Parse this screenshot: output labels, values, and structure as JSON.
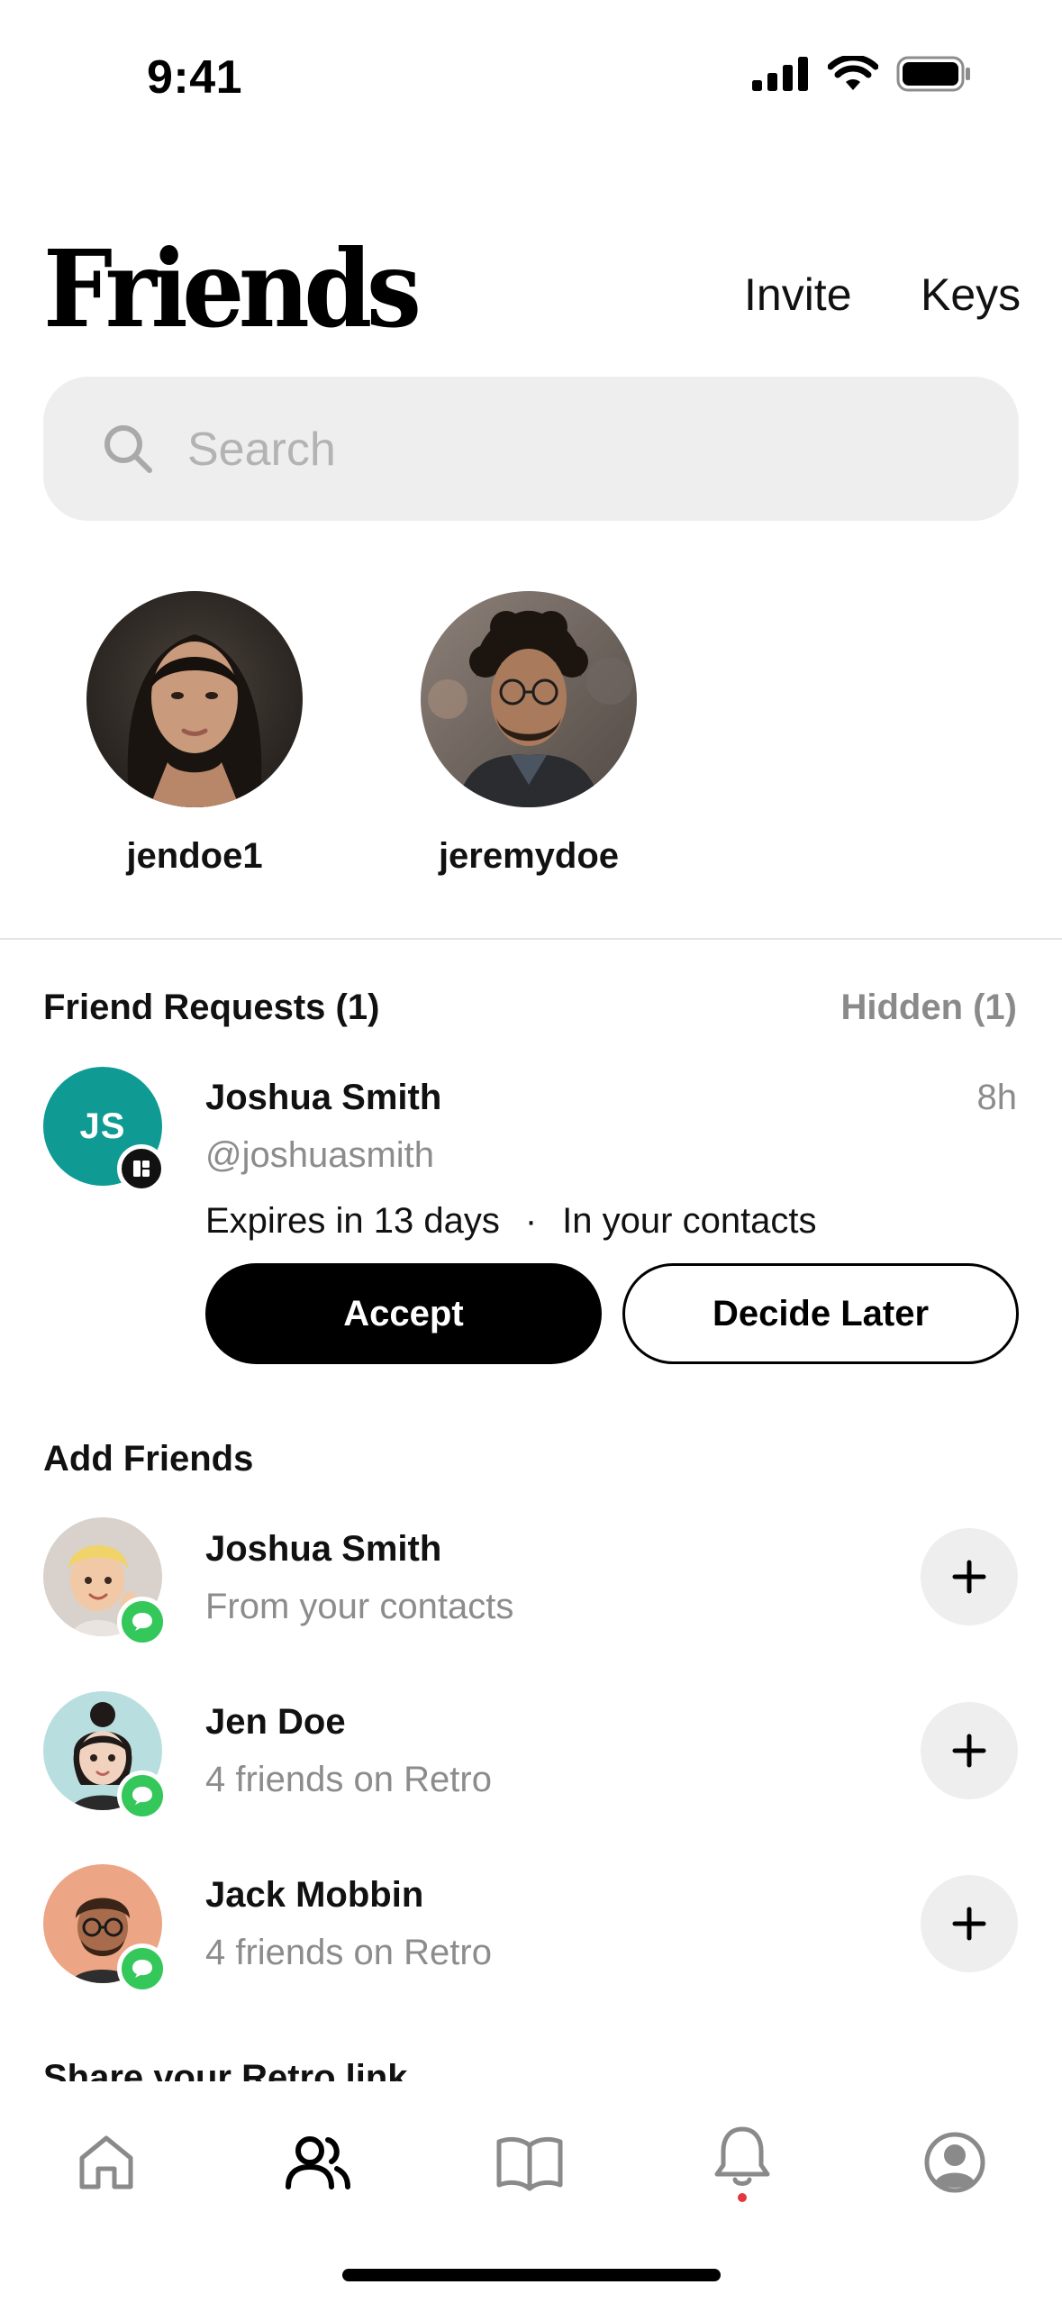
{
  "status_bar": {
    "time": "9:41",
    "icons": [
      "cellular-signal-icon",
      "wifi-icon",
      "battery-icon"
    ]
  },
  "header": {
    "title": "Friends",
    "invite_label": "Invite",
    "keys_label": "Keys"
  },
  "search": {
    "placeholder": "Search",
    "value": ""
  },
  "friends": [
    {
      "username": "jendoe1"
    },
    {
      "username": "jeremydoe"
    }
  ],
  "friend_requests": {
    "title": "Friend Requests (1)",
    "hidden_label": "Hidden (1)",
    "items": [
      {
        "initials": "JS",
        "name": "Joshua Smith",
        "handle": "@joshuasmith",
        "time": "8h",
        "expires": "Expires in 13 days",
        "separator": "·",
        "context": "In your contacts",
        "accept_label": "Accept",
        "decide_later_label": "Decide Later"
      }
    ]
  },
  "add_friends": {
    "title": "Add Friends",
    "items": [
      {
        "name": "Joshua Smith",
        "subtitle": "From your contacts"
      },
      {
        "name": "Jen Doe",
        "subtitle": "4 friends on Retro"
      },
      {
        "name": "Jack Mobbin",
        "subtitle": "4 friends on Retro"
      }
    ]
  },
  "share_section": {
    "title": "Share your Retro link"
  },
  "tab_bar": {
    "tabs": [
      "home-icon",
      "friends-icon",
      "book-icon",
      "bell-icon",
      "profile-icon"
    ],
    "active": "friends-icon"
  },
  "colors": {
    "accent": "#0f9b94",
    "message_badge": "#34c759",
    "notification_dot": "#e0383e"
  }
}
